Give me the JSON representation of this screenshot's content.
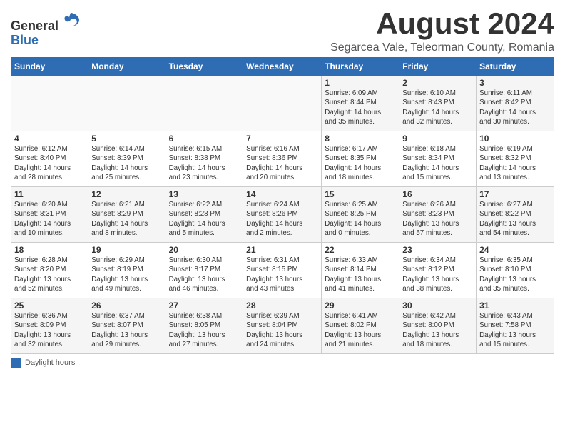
{
  "header": {
    "logo_line1": "General",
    "logo_line2": "Blue",
    "month_title": "August 2024",
    "subtitle": "Segarcea Vale, Teleorman County, Romania"
  },
  "weekdays": [
    "Sunday",
    "Monday",
    "Tuesday",
    "Wednesday",
    "Thursday",
    "Friday",
    "Saturday"
  ],
  "weeks": [
    [
      {
        "day": "",
        "info": ""
      },
      {
        "day": "",
        "info": ""
      },
      {
        "day": "",
        "info": ""
      },
      {
        "day": "",
        "info": ""
      },
      {
        "day": "1",
        "info": "Sunrise: 6:09 AM\nSunset: 8:44 PM\nDaylight: 14 hours\nand 35 minutes."
      },
      {
        "day": "2",
        "info": "Sunrise: 6:10 AM\nSunset: 8:43 PM\nDaylight: 14 hours\nand 32 minutes."
      },
      {
        "day": "3",
        "info": "Sunrise: 6:11 AM\nSunset: 8:42 PM\nDaylight: 14 hours\nand 30 minutes."
      }
    ],
    [
      {
        "day": "4",
        "info": "Sunrise: 6:12 AM\nSunset: 8:40 PM\nDaylight: 14 hours\nand 28 minutes."
      },
      {
        "day": "5",
        "info": "Sunrise: 6:14 AM\nSunset: 8:39 PM\nDaylight: 14 hours\nand 25 minutes."
      },
      {
        "day": "6",
        "info": "Sunrise: 6:15 AM\nSunset: 8:38 PM\nDaylight: 14 hours\nand 23 minutes."
      },
      {
        "day": "7",
        "info": "Sunrise: 6:16 AM\nSunset: 8:36 PM\nDaylight: 14 hours\nand 20 minutes."
      },
      {
        "day": "8",
        "info": "Sunrise: 6:17 AM\nSunset: 8:35 PM\nDaylight: 14 hours\nand 18 minutes."
      },
      {
        "day": "9",
        "info": "Sunrise: 6:18 AM\nSunset: 8:34 PM\nDaylight: 14 hours\nand 15 minutes."
      },
      {
        "day": "10",
        "info": "Sunrise: 6:19 AM\nSunset: 8:32 PM\nDaylight: 14 hours\nand 13 minutes."
      }
    ],
    [
      {
        "day": "11",
        "info": "Sunrise: 6:20 AM\nSunset: 8:31 PM\nDaylight: 14 hours\nand 10 minutes."
      },
      {
        "day": "12",
        "info": "Sunrise: 6:21 AM\nSunset: 8:29 PM\nDaylight: 14 hours\nand 8 minutes."
      },
      {
        "day": "13",
        "info": "Sunrise: 6:22 AM\nSunset: 8:28 PM\nDaylight: 14 hours\nand 5 minutes."
      },
      {
        "day": "14",
        "info": "Sunrise: 6:24 AM\nSunset: 8:26 PM\nDaylight: 14 hours\nand 2 minutes."
      },
      {
        "day": "15",
        "info": "Sunrise: 6:25 AM\nSunset: 8:25 PM\nDaylight: 14 hours\nand 0 minutes."
      },
      {
        "day": "16",
        "info": "Sunrise: 6:26 AM\nSunset: 8:23 PM\nDaylight: 13 hours\nand 57 minutes."
      },
      {
        "day": "17",
        "info": "Sunrise: 6:27 AM\nSunset: 8:22 PM\nDaylight: 13 hours\nand 54 minutes."
      }
    ],
    [
      {
        "day": "18",
        "info": "Sunrise: 6:28 AM\nSunset: 8:20 PM\nDaylight: 13 hours\nand 52 minutes."
      },
      {
        "day": "19",
        "info": "Sunrise: 6:29 AM\nSunset: 8:19 PM\nDaylight: 13 hours\nand 49 minutes."
      },
      {
        "day": "20",
        "info": "Sunrise: 6:30 AM\nSunset: 8:17 PM\nDaylight: 13 hours\nand 46 minutes."
      },
      {
        "day": "21",
        "info": "Sunrise: 6:31 AM\nSunset: 8:15 PM\nDaylight: 13 hours\nand 43 minutes."
      },
      {
        "day": "22",
        "info": "Sunrise: 6:33 AM\nSunset: 8:14 PM\nDaylight: 13 hours\nand 41 minutes."
      },
      {
        "day": "23",
        "info": "Sunrise: 6:34 AM\nSunset: 8:12 PM\nDaylight: 13 hours\nand 38 minutes."
      },
      {
        "day": "24",
        "info": "Sunrise: 6:35 AM\nSunset: 8:10 PM\nDaylight: 13 hours\nand 35 minutes."
      }
    ],
    [
      {
        "day": "25",
        "info": "Sunrise: 6:36 AM\nSunset: 8:09 PM\nDaylight: 13 hours\nand 32 minutes."
      },
      {
        "day": "26",
        "info": "Sunrise: 6:37 AM\nSunset: 8:07 PM\nDaylight: 13 hours\nand 29 minutes."
      },
      {
        "day": "27",
        "info": "Sunrise: 6:38 AM\nSunset: 8:05 PM\nDaylight: 13 hours\nand 27 minutes."
      },
      {
        "day": "28",
        "info": "Sunrise: 6:39 AM\nSunset: 8:04 PM\nDaylight: 13 hours\nand 24 minutes."
      },
      {
        "day": "29",
        "info": "Sunrise: 6:41 AM\nSunset: 8:02 PM\nDaylight: 13 hours\nand 21 minutes."
      },
      {
        "day": "30",
        "info": "Sunrise: 6:42 AM\nSunset: 8:00 PM\nDaylight: 13 hours\nand 18 minutes."
      },
      {
        "day": "31",
        "info": "Sunrise: 6:43 AM\nSunset: 7:58 PM\nDaylight: 13 hours\nand 15 minutes."
      }
    ]
  ],
  "footer": {
    "label": "Daylight hours"
  }
}
